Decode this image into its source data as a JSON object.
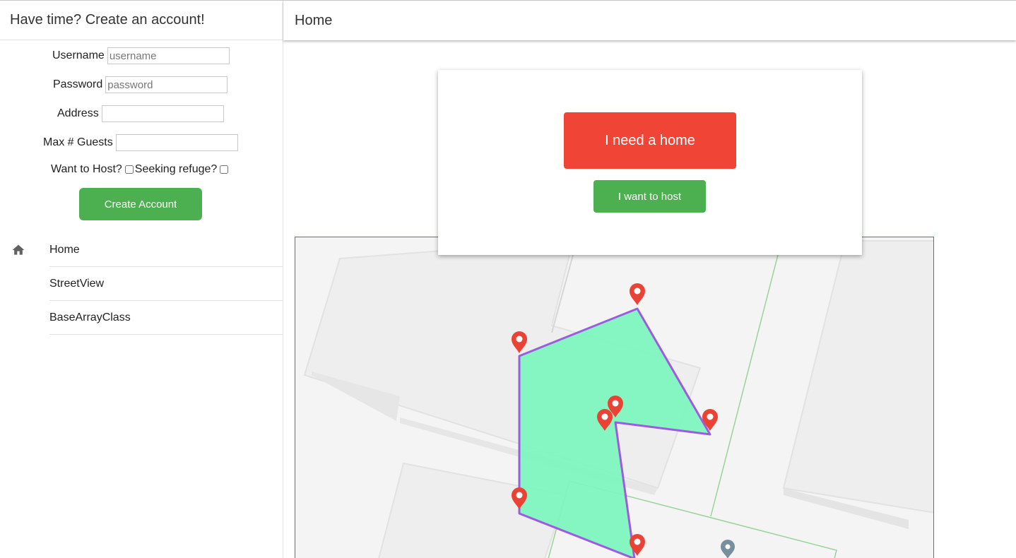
{
  "sidebar": {
    "title": "Have time? Create an account!",
    "form": {
      "username_label": "Username",
      "username_placeholder": "username",
      "password_label": "Password",
      "password_placeholder": "password",
      "address_label": "Address",
      "address_value": "",
      "max_guests_label": "Max # Guests",
      "max_guests_value": "",
      "want_host_label": "Want to Host?",
      "seeking_refuge_label": "Seeking refuge?",
      "create_button": "Create Account"
    },
    "nav": [
      {
        "label": "Home",
        "icon": "home-icon"
      },
      {
        "label": "StreetView"
      },
      {
        "label": "BaseArrayClass"
      }
    ]
  },
  "main": {
    "title": "Home",
    "card": {
      "need_home_button": "I need a home",
      "want_host_button": "I want to host"
    },
    "map": {
      "polygon_fill": "#7ef5be",
      "polygon_stroke": "#9c5ce0",
      "marker_color": "#ea4335",
      "user_marker_color": "#78909c"
    }
  },
  "colors": {
    "primary_green": "#4caf50",
    "accent_red": "#f04436"
  }
}
